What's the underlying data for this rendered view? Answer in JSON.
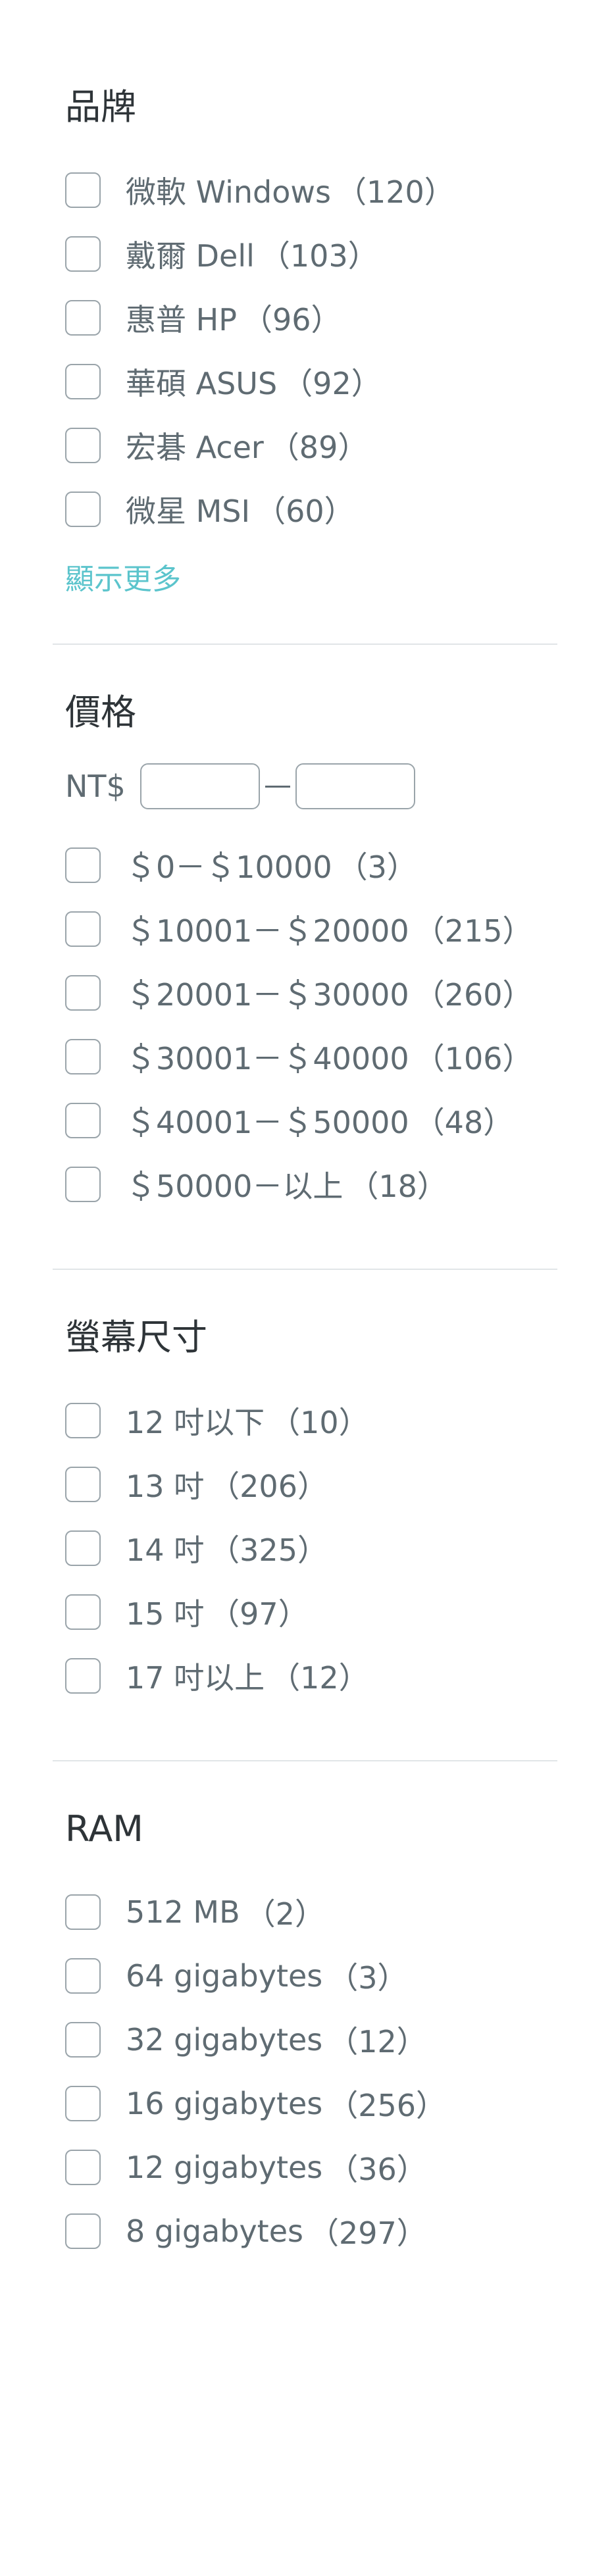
{
  "brand": {
    "title": "品牌",
    "items": [
      {
        "label": "微軟 Windows",
        "count": "（120）"
      },
      {
        "label": "戴爾 Dell",
        "count": "（103）"
      },
      {
        "label": "惠普 HP",
        "count": "（96）"
      },
      {
        "label": "華碩 ASUS",
        "count": "（92）"
      },
      {
        "label": "宏碁 Acer",
        "count": "（89）"
      },
      {
        "label": "微星 MSI",
        "count": "（60）"
      }
    ],
    "show_more": "顯示更多"
  },
  "price": {
    "title": "價格",
    "currency": "NT$",
    "min_value": "",
    "max_value": "",
    "items": [
      {
        "label": "＄0－＄10000",
        "count": "（3）"
      },
      {
        "label": "＄10001－＄20000",
        "count": "（215）"
      },
      {
        "label": "＄20001－＄30000",
        "count": "（260）"
      },
      {
        "label": "＄30001－＄40000",
        "count": "（106）"
      },
      {
        "label": "＄40001－＄50000",
        "count": "（48）"
      },
      {
        "label": "＄50000－以上",
        "count": "（18）"
      }
    ]
  },
  "screen": {
    "title": "螢幕尺寸",
    "items": [
      {
        "label": "12 吋以下",
        "count": "（10）"
      },
      {
        "label": "13 吋",
        "count": "（206）"
      },
      {
        "label": "14 吋",
        "count": "（325）"
      },
      {
        "label": "15 吋",
        "count": "（97）"
      },
      {
        "label": "17 吋以上",
        "count": "（12）"
      }
    ]
  },
  "ram": {
    "title": "RAM",
    "items": [
      {
        "label": "512 MB",
        "count": "（2）"
      },
      {
        "label": "64 gigabytes",
        "count": "（3）"
      },
      {
        "label": "32 gigabytes",
        "count": "（12）"
      },
      {
        "label": "16 gigabytes",
        "count": "（256）"
      },
      {
        "label": "12 gigabytes",
        "count": "（36）"
      },
      {
        "label": "8 gigabytes",
        "count": "（297）"
      }
    ]
  }
}
